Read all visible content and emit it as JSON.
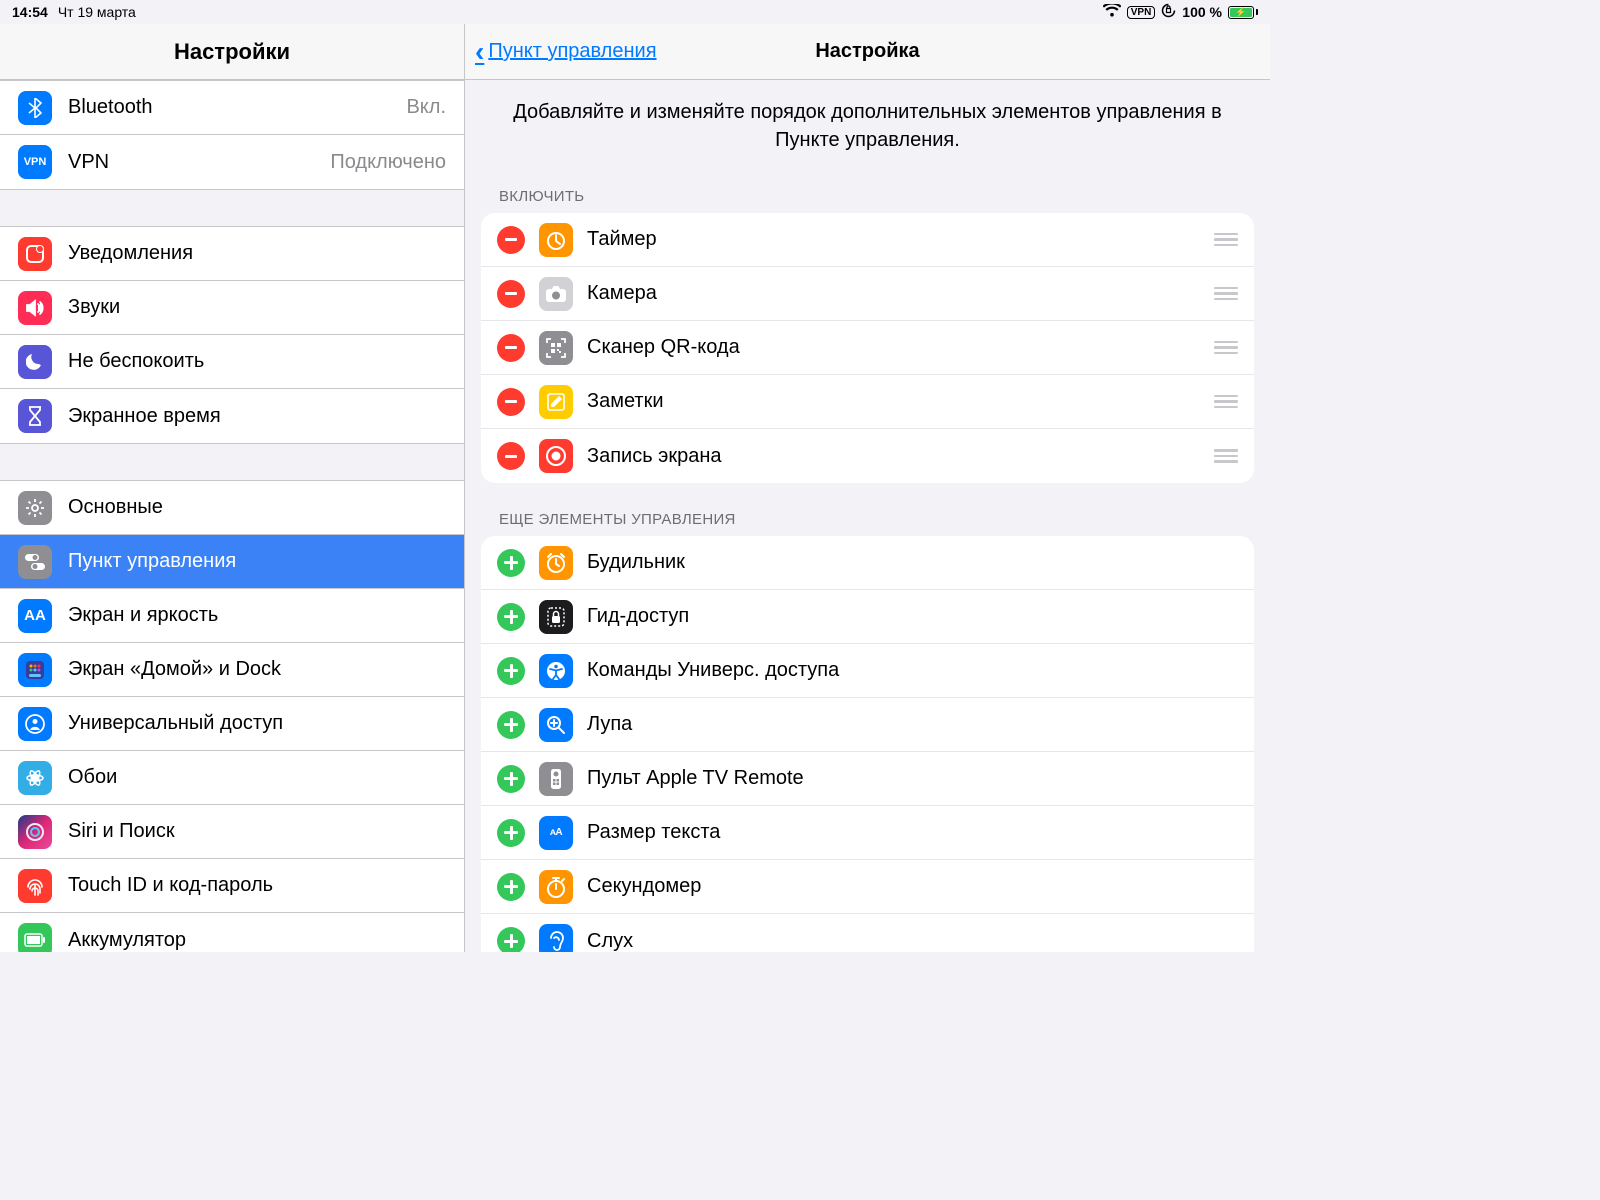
{
  "statusbar": {
    "time": "14:54",
    "date": "Чт 19 марта",
    "vpn": "VPN",
    "battery": "100 %"
  },
  "sidebar": {
    "title": "Настройки",
    "group1": [
      {
        "label": "Bluetooth",
        "value": "Вкл.",
        "icon": "bt",
        "bg": "bg-blue"
      },
      {
        "label": "VPN",
        "value": "Подключено",
        "icon": "vpn",
        "bg": "bg-blue"
      }
    ],
    "group2": [
      {
        "label": "Уведомления",
        "icon": "bell",
        "bg": "bg-red"
      },
      {
        "label": "Звуки",
        "icon": "sound",
        "bg": "bg-pink"
      },
      {
        "label": "Не беспокоить",
        "icon": "moon",
        "bg": "bg-indigo"
      },
      {
        "label": "Экранное время",
        "icon": "hourglass",
        "bg": "bg-indigo"
      }
    ],
    "group3": [
      {
        "label": "Основные",
        "icon": "gear",
        "bg": "bg-grey"
      },
      {
        "label": "Пункт управления",
        "icon": "toggles",
        "bg": "bg-grey",
        "selected": true
      },
      {
        "label": "Экран и яркость",
        "icon": "AA",
        "bg": "bg-blue"
      },
      {
        "label": "Экран «Домой» и Dock",
        "icon": "grid",
        "bg": "bg-blue"
      },
      {
        "label": "Универсальный доступ",
        "icon": "person",
        "bg": "bg-blue"
      },
      {
        "label": "Обои",
        "icon": "flower",
        "bg": "bg-teal"
      },
      {
        "label": "Siri и Поиск",
        "icon": "siri",
        "bg": "gradient-siri"
      },
      {
        "label": "Touch ID и код-пароль",
        "icon": "finger",
        "bg": "bg-red"
      },
      {
        "label": "Аккумулятор",
        "icon": "batt",
        "bg": "bg-green"
      }
    ]
  },
  "detail": {
    "back": "Пункт управления",
    "title": "Настройка",
    "desc": "Добавляйте и изменяйте порядок дополнительных элементов управления в Пункте управления.",
    "include_header": "ВКЛЮЧИТЬ",
    "include": [
      {
        "label": "Таймер",
        "bg": "bg-orange",
        "icon": "timer"
      },
      {
        "label": "Камера",
        "bg": "bg-grey-light",
        "icon": "camera"
      },
      {
        "label": "Сканер QR-кода",
        "bg": "bg-grey",
        "icon": "qr"
      },
      {
        "label": "Заметки",
        "bg": "bg-yellow",
        "icon": "note"
      },
      {
        "label": "Запись экрана",
        "bg": "bg-red",
        "icon": "rec"
      }
    ],
    "more_header": "ЕЩЕ ЭЛЕМЕНТЫ УПРАВЛЕНИЯ",
    "more": [
      {
        "label": "Будильник",
        "bg": "bg-orange",
        "icon": "alarm"
      },
      {
        "label": "Гид-доступ",
        "bg": "bg-black",
        "icon": "lock"
      },
      {
        "label": "Команды Универс. доступа",
        "bg": "bg-blue",
        "icon": "access"
      },
      {
        "label": "Лупа",
        "bg": "bg-blue",
        "icon": "mag"
      },
      {
        "label": "Пульт Apple TV Remote",
        "bg": "bg-grey",
        "icon": "remote"
      },
      {
        "label": "Размер текста",
        "bg": "bg-blue",
        "icon": "textsize"
      },
      {
        "label": "Секундомер",
        "bg": "bg-orange",
        "icon": "stopwatch"
      },
      {
        "label": "Слух",
        "bg": "bg-blue",
        "icon": "ear"
      }
    ]
  }
}
